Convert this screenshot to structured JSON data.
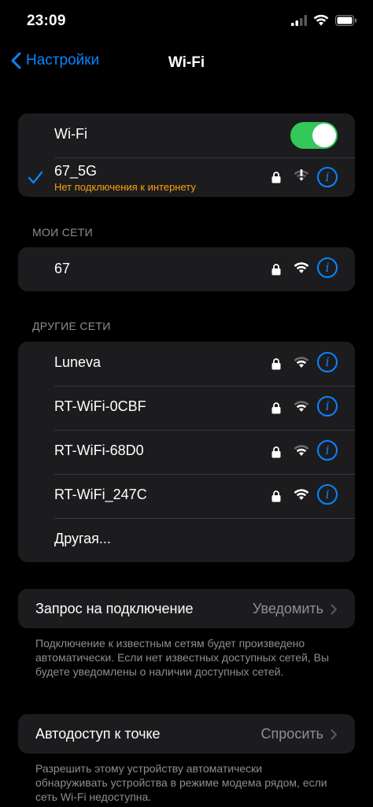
{
  "status": {
    "time": "23:09"
  },
  "nav": {
    "back_label": "Настройки",
    "title": "Wi-Fi"
  },
  "wifi_main": {
    "toggle_label": "Wi-Fi",
    "toggle_on": true,
    "current_network": {
      "name": "67_5G",
      "status": "Нет подключения к интернету",
      "secured": true
    }
  },
  "my_networks": {
    "header": "МОИ СЕТИ",
    "items": [
      {
        "name": "67",
        "secured": true
      }
    ]
  },
  "other_networks": {
    "header": "ДРУГИЕ СЕТИ",
    "items": [
      {
        "name": "Luneva",
        "secured": true
      },
      {
        "name": "RT-WiFi-0CBF",
        "secured": true
      },
      {
        "name": "RT-WiFi-68D0",
        "secured": true
      },
      {
        "name": "RT-WiFi_247C",
        "secured": true
      }
    ],
    "other_label": "Другая..."
  },
  "ask_to_join": {
    "label": "Запрос на подключение",
    "value": "Уведомить",
    "footnote": "Подключение к известным сетям будет произведено автоматически. Если нет известных доступных сетей, Вы будете уведомлены о наличии доступных сетей."
  },
  "auto_hotspot": {
    "label": "Автодоступ к точке",
    "value": "Спросить",
    "footnote": "Разрешить этому устройству автоматически обнаруживать устройства в режиме модема рядом, если сеть Wi-Fi недоступна."
  },
  "colors": {
    "accent": "#0a84ff",
    "toggle_on": "#34c759",
    "warning": "#ff9f0a",
    "cell_bg": "#1c1c1e",
    "secondary_text": "#8e8e93"
  },
  "icons": {
    "lock": "lock-icon",
    "wifi": "wifi-signal-icon",
    "wifi_no_internet": "wifi-exclamation-icon",
    "info": "info-icon",
    "check": "checkmark-icon",
    "chevron": "chevron-right-icon",
    "back": "chevron-left-icon"
  }
}
